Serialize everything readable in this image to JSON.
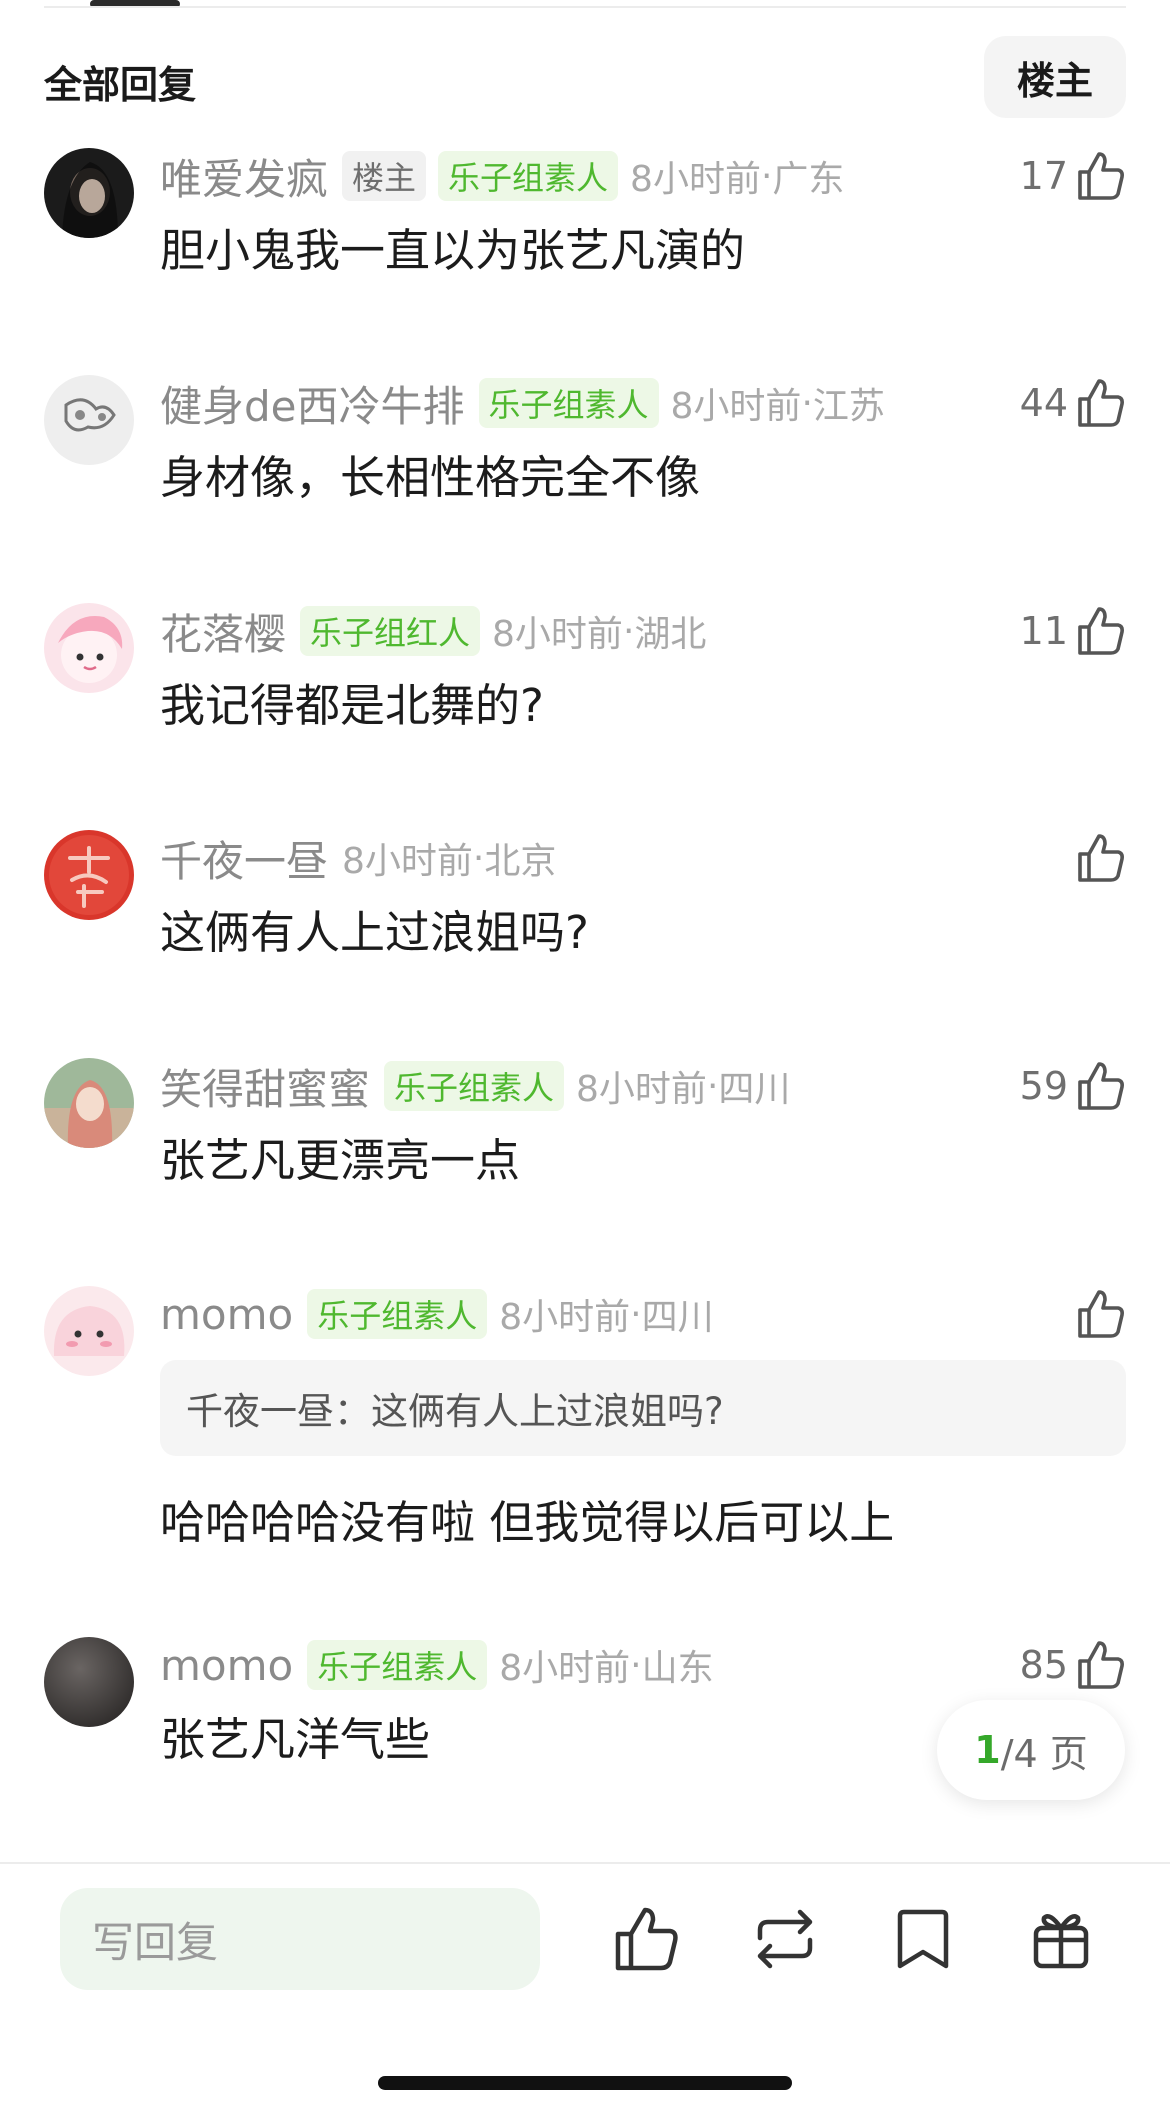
{
  "header": {
    "title": "全部回复",
    "filter_label": "楼主"
  },
  "comments": [
    {
      "username": "唯爱发疯",
      "op_badge": "楼主",
      "badge": "乐子组素人",
      "time": "8小时前",
      "location": "广东",
      "likes": "17",
      "text": "胆小鬼我一直以为张艺凡演的",
      "avatar": "dark-portrait-avatar"
    },
    {
      "username": "健身de西冷牛排",
      "badge": "乐子组素人",
      "time": "8小时前",
      "location": "江苏",
      "likes": "44",
      "text": "身材像，长相性格完全不像",
      "avatar": "sketch-avatar"
    },
    {
      "username": "花落樱",
      "badge": "乐子组红人",
      "time": "8小时前",
      "location": "湖北",
      "likes": "11",
      "text": "我记得都是北舞的?",
      "avatar": "pink-anime-avatar"
    },
    {
      "username": "千夜一昼",
      "time": "8小时前",
      "location": "北京",
      "likes": "",
      "text": "这俩有人上过浪姐吗?",
      "avatar": "red-seal-avatar"
    },
    {
      "username": "笑得甜蜜蜜",
      "badge": "乐子组素人",
      "time": "8小时前",
      "location": "四川",
      "likes": "59",
      "text": "张艺凡更漂亮一点",
      "avatar": "girl-photo-avatar"
    },
    {
      "username": "momo",
      "badge": "乐子组素人",
      "time": "8小时前",
      "location": "四川",
      "likes": "",
      "quote_author": "千夜一昼",
      "quote_text": "这俩有人上过浪姐吗?",
      "text": "哈哈哈哈没有啦 但我觉得以后可以上",
      "avatar": "pink-blob-avatar"
    },
    {
      "username": "momo",
      "badge": "乐子组素人",
      "time": "8小时前",
      "location": "山东",
      "likes": "85",
      "text": "张艺凡洋气些",
      "avatar": "gray-avatar"
    }
  ],
  "pager": {
    "current": "1",
    "rest": "/4 页"
  },
  "bottom_bar": {
    "reply_placeholder": "写回复",
    "actions": [
      "thumbs-up-icon",
      "repost-icon",
      "bookmark-icon",
      "gift-icon"
    ]
  },
  "colors": {
    "badge_green_text": "#4fb82f",
    "badge_green_bg": "#edf8e6",
    "accent": "#35a82a",
    "reply_bg": "#eef6ee"
  }
}
